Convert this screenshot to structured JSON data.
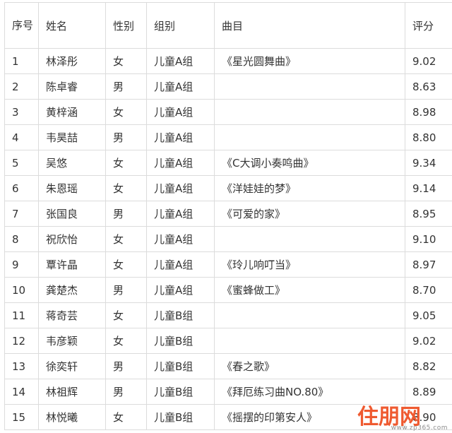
{
  "table": {
    "headers": {
      "no": "序号",
      "name": "姓名",
      "gender": "性别",
      "group": "组别",
      "piece": "曲目",
      "score": "评分"
    },
    "rows": [
      {
        "no": "1",
        "name": "林泽彤",
        "gender": "女",
        "group": "儿童A组",
        "piece": "《星光圆舞曲》",
        "score": "9.02"
      },
      {
        "no": "2",
        "name": "陈卓睿",
        "gender": "男",
        "group": "儿童A组",
        "piece": "",
        "score": "8.63"
      },
      {
        "no": "3",
        "name": "黄梓涵",
        "gender": "女",
        "group": "儿童A组",
        "piece": "",
        "score": "8.98"
      },
      {
        "no": "4",
        "name": "韦昊喆",
        "gender": "男",
        "group": "儿童A组",
        "piece": "",
        "score": "8.80"
      },
      {
        "no": "5",
        "name": "吴悠",
        "gender": "女",
        "group": "儿童A组",
        "piece": "《C大调小奏鸣曲》",
        "score": "9.34"
      },
      {
        "no": "6",
        "name": "朱恩瑶",
        "gender": "女",
        "group": "儿童A组",
        "piece": "《洋娃娃的梦》",
        "score": "9.14"
      },
      {
        "no": "7",
        "name": "张国良",
        "gender": "男",
        "group": "儿童A组",
        "piece": "《可爱的家》",
        "score": "8.95"
      },
      {
        "no": "8",
        "name": "祝欣怡",
        "gender": "女",
        "group": "儿童A组",
        "piece": "",
        "score": "9.10"
      },
      {
        "no": "9",
        "name": "覃许晶",
        "gender": "女",
        "group": "儿童A组",
        "piece": "《玲儿响叮当》",
        "score": "8.97"
      },
      {
        "no": "10",
        "name": "龚楚杰",
        "gender": "男",
        "group": "儿童A组",
        "piece": "《蜜蜂做工》",
        "score": "8.70"
      },
      {
        "no": "11",
        "name": "蒋奇芸",
        "gender": "女",
        "group": "儿童B组",
        "piece": "",
        "score": "9.05"
      },
      {
        "no": "12",
        "name": "韦彦颖",
        "gender": "女",
        "group": "儿童B组",
        "piece": "",
        "score": "9.02"
      },
      {
        "no": "13",
        "name": "徐奕轩",
        "gender": "男",
        "group": "儿童B组",
        "piece": "《春之歌》",
        "score": "8.82"
      },
      {
        "no": "14",
        "name": "林祖辉",
        "gender": "男",
        "group": "儿童B组",
        "piece": "《拜厄练习曲NO.80》",
        "score": "8.89"
      },
      {
        "no": "15",
        "name": "林悦曦",
        "gender": "女",
        "group": "儿童B组",
        "piece": "《摇摆的印第安人》",
        "score": "8.90"
      }
    ]
  },
  "watermark": {
    "logo_text": "住朋网",
    "domain": "www.zp365.com",
    "color": "#ef5a30"
  }
}
